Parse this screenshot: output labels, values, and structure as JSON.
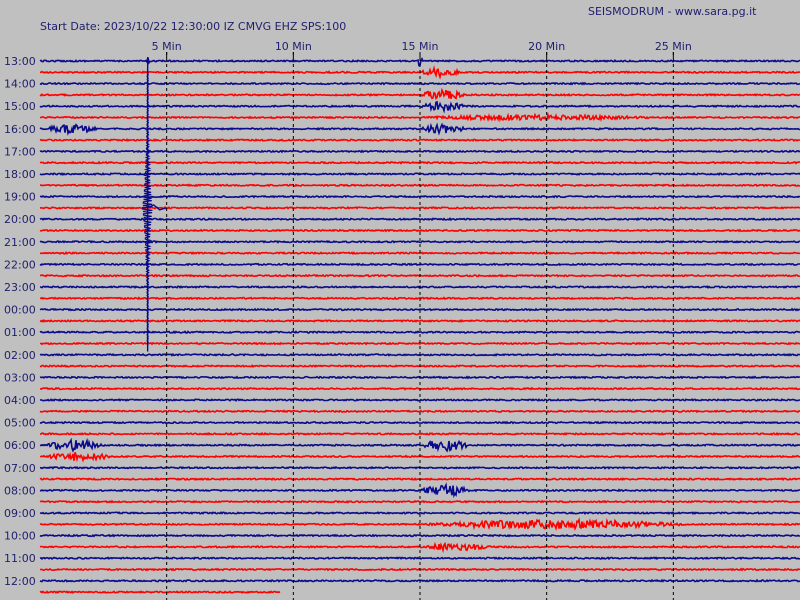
{
  "header": {
    "start_label": "Start Date: 2023/10/22 12:30:00 IZ CMVG EHZ SPS:100",
    "site_label": "SEISMODRUM - www.sara.pg.it"
  },
  "colors": {
    "background": "#c0c0c0",
    "trace_blue": "#0a0a8c",
    "trace_red": "#ff0000",
    "grid": "#000000",
    "text": "#1e1e6e"
  },
  "chart_data": {
    "type": "line",
    "minute_ticks": [
      {
        "minute": 5,
        "label": "5 Min"
      },
      {
        "minute": 10,
        "label": "10 Min"
      },
      {
        "minute": 15,
        "label": "15 Min"
      },
      {
        "minute": 20,
        "label": "20 Min"
      },
      {
        "minute": 25,
        "label": "25 Min"
      }
    ],
    "x_range_minutes": [
      0,
      30
    ],
    "hour_labels": [
      "13:00",
      "14:00",
      "15:00",
      "16:00",
      "17:00",
      "18:00",
      "19:00",
      "20:00",
      "21:00",
      "22:00",
      "23:00",
      "00:00",
      "01:00",
      "02:00",
      "03:00",
      "04:00",
      "05:00",
      "06:00",
      "07:00",
      "08:00",
      "09:00",
      "10:00",
      "11:00",
      "12:00"
    ],
    "traces_per_hour": 2,
    "trace_colors": [
      "blue",
      "red"
    ],
    "last_trace_end_minute": 9.5,
    "events": [
      {
        "trace": 0,
        "start_min": 4.2,
        "end_min": 4.4,
        "amplitude": 3,
        "kind": "spike"
      },
      {
        "trace": 0,
        "start_min": 14.9,
        "end_min": 15.2,
        "amplitude": 5,
        "kind": "burst"
      },
      {
        "trace": 1,
        "start_min": 15.0,
        "end_min": 17.3,
        "amplitude": 4,
        "kind": "burst"
      },
      {
        "trace": 3,
        "start_min": 15.0,
        "end_min": 17.5,
        "amplitude": 5,
        "kind": "burst"
      },
      {
        "trace": 4,
        "start_min": 15.0,
        "end_min": 17.6,
        "amplitude": 4,
        "kind": "burst"
      },
      {
        "trace": 5,
        "start_min": 15.0,
        "end_min": 28.0,
        "amplitude": 2,
        "kind": "burst"
      },
      {
        "trace": 6,
        "start_min": 0.2,
        "end_min": 3.2,
        "amplitude": 4,
        "kind": "burst"
      },
      {
        "trace": 6,
        "start_min": 15.0,
        "end_min": 17.6,
        "amplitude": 4,
        "kind": "burst"
      },
      {
        "trace": 34,
        "start_min": 0.2,
        "end_min": 3.5,
        "amplitude": 5,
        "kind": "burst"
      },
      {
        "trace": 35,
        "start_min": 0.2,
        "end_min": 4.0,
        "amplitude": 4,
        "kind": "burst"
      },
      {
        "trace": 34,
        "start_min": 15.0,
        "end_min": 17.8,
        "amplitude": 5,
        "kind": "burst"
      },
      {
        "trace": 38,
        "start_min": 15.0,
        "end_min": 17.8,
        "amplitude": 5,
        "kind": "burst"
      },
      {
        "trace": 41,
        "start_min": 15.0,
        "end_min": 30.0,
        "amplitude": 4,
        "kind": "burst"
      },
      {
        "trace": 43,
        "start_min": 15.0,
        "end_min": 19.0,
        "amplitude": 3,
        "kind": "burst"
      }
    ],
    "large_event": {
      "minute": 4.25,
      "first_trace": 0,
      "last_trace": 25,
      "peak_trace": 13
    }
  }
}
